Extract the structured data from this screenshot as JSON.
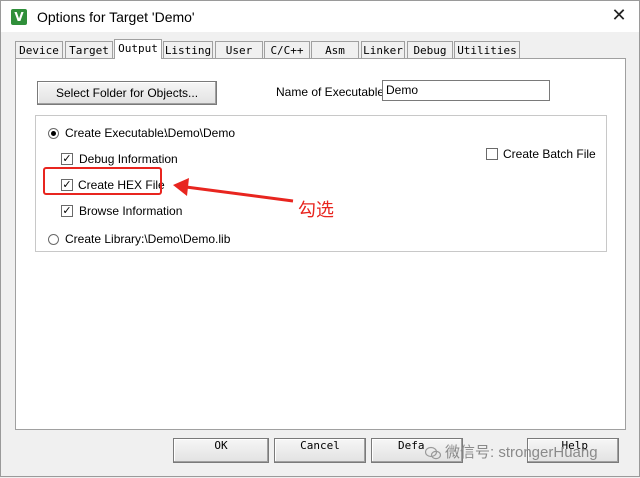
{
  "window": {
    "title": "Options for Target 'Demo'",
    "close": "✕"
  },
  "tabs": [
    {
      "label": "Device"
    },
    {
      "label": "Target"
    },
    {
      "label": "Output"
    },
    {
      "label": "Listing"
    },
    {
      "label": "User"
    },
    {
      "label": "C/C++"
    },
    {
      "label": "Asm"
    },
    {
      "label": "Linker"
    },
    {
      "label": "Debug"
    },
    {
      "label": "Utilities"
    }
  ],
  "active_tab": "Output",
  "output": {
    "select_folder_label": "Select Folder for Objects...",
    "name_label": "Name of Executable:",
    "name_value": "Demo",
    "create_exe_label": "Create Executable:",
    "create_exe_path": ".\\Demo\\Demo",
    "debug_info_label": "Debug Information",
    "create_hex_label": "Create HEX File",
    "browse_info_label": "Browse Information",
    "create_lib_label": "Create Library:",
    "create_lib_path": ".\\Demo\\Demo.lib",
    "create_batch_label": "Create Batch File"
  },
  "annotation": {
    "text": "勾选",
    "color": "#e8251f"
  },
  "buttons": {
    "ok": "OK",
    "cancel": "Cancel",
    "defaults": "Defa",
    "help": "Help"
  },
  "watermark": {
    "text": "微信号: strongerHuang"
  }
}
